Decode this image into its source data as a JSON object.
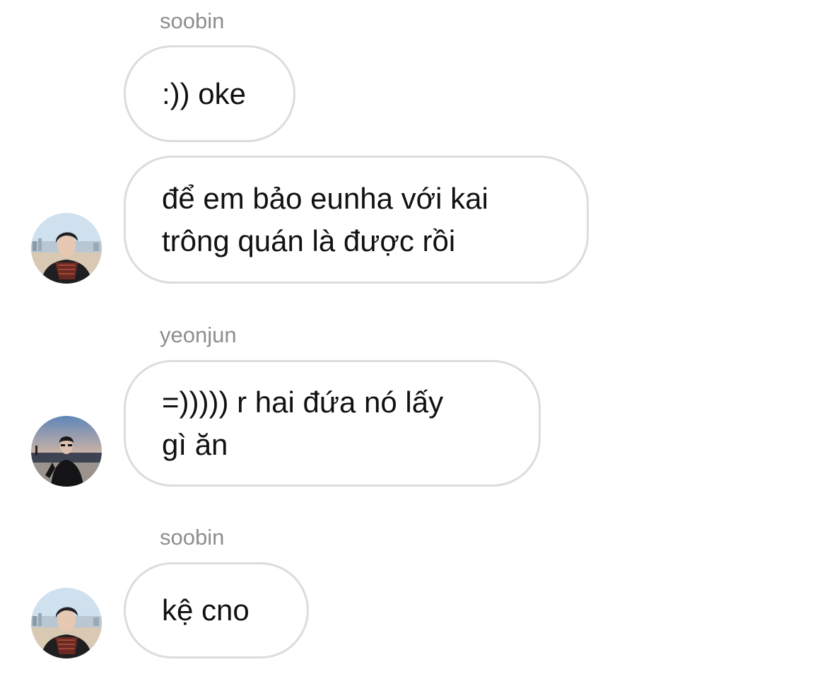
{
  "chat": {
    "groups": [
      {
        "sender": "soobin",
        "messages": [
          ":)) oke",
          "để em bảo eunha với kai\ntrông quán là được rồi"
        ]
      },
      {
        "sender": "yeonjun",
        "messages": [
          "=))))) r hai đứa nó lấy\ngì ăn"
        ]
      },
      {
        "sender": "soobin",
        "messages": [
          "kệ cno"
        ]
      }
    ]
  },
  "avatars": {
    "soobin": {
      "icon": "user-photo-beach-scarf"
    },
    "yeonjun": {
      "icon": "user-photo-dusk-sea"
    }
  },
  "colors": {
    "sender_text": "#8e8e8e",
    "bubble_border": "#dcdcdc",
    "message_text": "#111111",
    "background": "#ffffff"
  }
}
